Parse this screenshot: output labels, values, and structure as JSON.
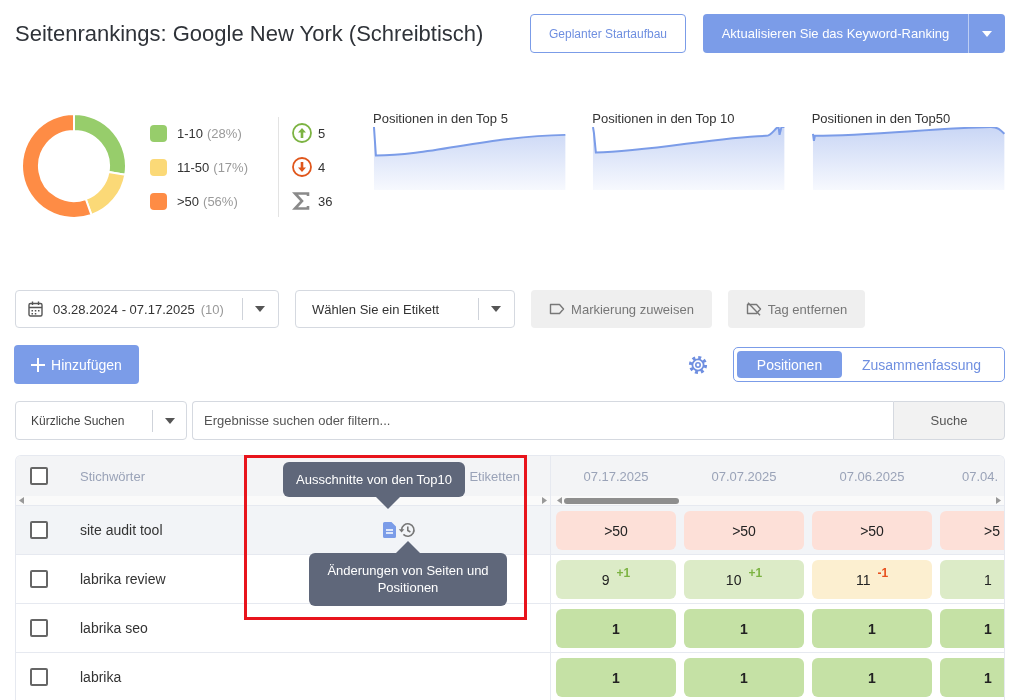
{
  "header": {
    "title": "Seitenrankings: Google New York (Schreibtisch)",
    "actions": [
      {
        "label": "Geplanter Startaufbau",
        "kind": "outline"
      },
      {
        "label": "Aktualisieren Sie das Keyword-Ranking",
        "kind": "split"
      }
    ]
  },
  "summary": {
    "chart_data": {
      "type": "donut",
      "categories": [
        "1-10",
        "11-50",
        ">50"
      ],
      "values": [
        28,
        17,
        56
      ]
    },
    "legend": [
      {
        "share": "(28%)",
        "color": "#97cd6b"
      },
      {
        "share": "(17%)",
        "color": "#fbd977"
      },
      {
        "share": "(56%)",
        "color": "#fe8c45"
      }
    ],
    "stats": [
      {
        "kind": "up",
        "value": "5"
      },
      {
        "kind": "down",
        "value": "4"
      },
      {
        "kind": "total",
        "value": "36"
      }
    ],
    "sparklines": [
      {
        "title": "Positionen in den Top 5"
      },
      {
        "title": "Positionen in den Top 10"
      },
      {
        "title": "Positionen in den Top50"
      }
    ]
  },
  "filters": {
    "date_range": {
      "value": "03.28.2024 - 07.17.2025",
      "count": "(10)"
    },
    "label_select": {
      "value": "Wählen Sie ein Etikett"
    },
    "tag_buttons": [
      {
        "label": "Markierung zuweisen",
        "kind": "assign",
        "disabled": true
      },
      {
        "label": "Tag entfernen",
        "kind": "remove",
        "disabled": true
      }
    ]
  },
  "toolbar": {
    "add_button": "Hinzufügen",
    "view_toggle": [
      {
        "label": "Positionen",
        "selected": true
      },
      {
        "label": "Zusammenfassung",
        "selected": false
      }
    ]
  },
  "search": {
    "recent": "Kürzliche Suchen",
    "placeholder": "Ergebnisse suchen oder filtern...",
    "button": "Suche"
  },
  "table": {
    "select_all": {
      "checked": false
    },
    "columns": [
      "Stichwörter",
      "Etiketten"
    ],
    "dates": [
      "07.17.2025",
      "07.07.2025",
      "07.06.2025",
      "07.04."
    ],
    "rows": [
      {
        "keyword": "site audit tool",
        "checked": false,
        "hovered": true,
        "positions": [
          {
            "value": ">50",
            "kind": "over50"
          },
          {
            "value": ">50",
            "kind": "over50"
          },
          {
            "value": ">50",
            "kind": "over50"
          },
          {
            "value": ">5",
            "kind": "over50"
          }
        ]
      },
      {
        "keyword": "labrika review",
        "checked": false,
        "hovered": false,
        "positions": [
          {
            "value": "9",
            "kind": "top10",
            "change": {
              "text": "+1",
              "color": "#7cb342"
            }
          },
          {
            "value": "10",
            "kind": "top10",
            "change": {
              "text": "+1",
              "color": "#7cb342"
            }
          },
          {
            "value": "11",
            "kind": "top50",
            "change": {
              "text": "-1",
              "color": "#e8501e"
            }
          },
          {
            "value": "1",
            "kind": "top10"
          }
        ]
      },
      {
        "keyword": "labrika seo",
        "checked": false,
        "hovered": false,
        "positions": [
          {
            "value": "1",
            "kind": "best"
          },
          {
            "value": "1",
            "kind": "best"
          },
          {
            "value": "1",
            "kind": "best"
          },
          {
            "value": "1",
            "kind": "best"
          }
        ]
      },
      {
        "keyword": "labrika",
        "checked": false,
        "hovered": false,
        "positions": [
          {
            "value": "1",
            "kind": "best"
          },
          {
            "value": "1",
            "kind": "best"
          },
          {
            "value": "1",
            "kind": "best"
          },
          {
            "value": "1",
            "kind": "best"
          }
        ]
      }
    ],
    "tooltips": [
      {
        "text": "Ausschnitte von den Top10",
        "kind": "above"
      },
      {
        "text": "Änderungen von Seiten und Positionen",
        "kind": "below"
      }
    ]
  },
  "highlight_frame": true
}
